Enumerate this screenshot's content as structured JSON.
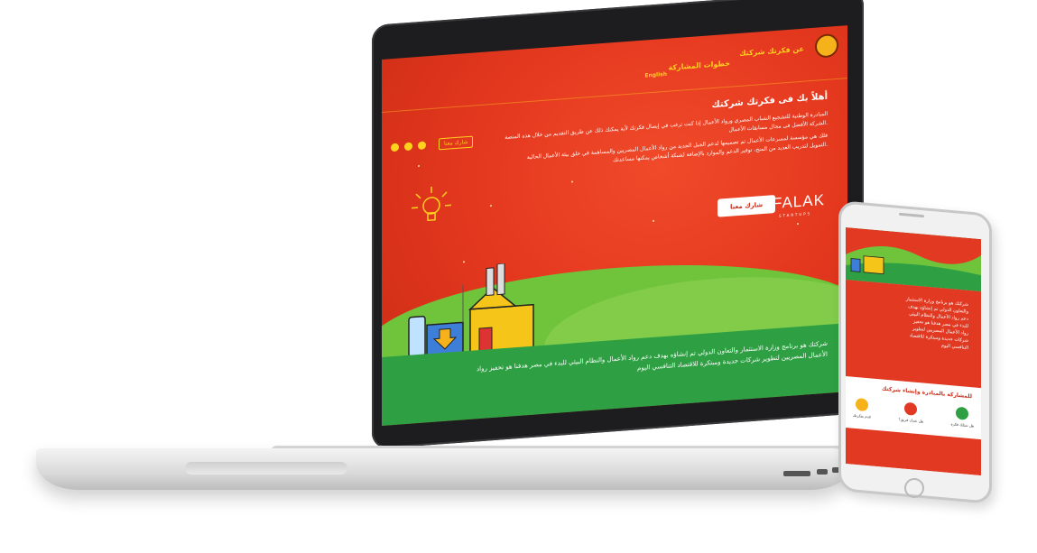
{
  "laptop_site": {
    "nav": {
      "brand_link": "عن فكرتك شركتك",
      "steps_link": "خطوات المشاركة",
      "lang_link": "English",
      "join_button": "شارك معنا"
    },
    "hero": {
      "title": "أهلاً بك فى فكرتك شركتك",
      "paragraph_lines": [
        "المبادرة الوطنية للتشجيع الشباب المصري ورواد الأعمال إذا كنت ترغب في إيصال فكرتك لأية يمكنك ذلك عن طريق التقديم من خلال هذه المنصة",
        "الشركة الأفضل فى مجال مسابقات الأعمال.",
        "فلك هي مؤسسة لمسرعات الأعمال تم تصميمها لدعم الجيل الجديد من رواد الأعمال المصريين والمساهمة في خلق بيئة الأعمال الحالية",
        "التمويل لتدريب العديد من المنح، توفير الدعم والموارد بالإضافة لشبكة أشخاص يمكنها مساعدتك."
      ],
      "cta_button": "شارك معنا",
      "partner_logo": "FALAK",
      "partner_logo_sub": "STARTUPS"
    },
    "footer_lines": [
      "شركتك هو برنامج وزارة الاستثمار والتعاون الدولي تم إنشاؤه بهدف دعم رواد الأعمال والنظام البيئي للبدء في مصر هدفنا هو تحفيز رواد",
      "الأعمال المصريين لتطوير شركات جديدة ومبتكرة للاقتصاد التنافسي اليوم"
    ],
    "colors": {
      "bg": "#e5391f",
      "accent": "#ffd21e",
      "grass": "#2ea043"
    }
  },
  "phone_site": {
    "intro_lines": [
      "شركتك هو برنامج وزارة الاستثمار",
      "والتعاون الدولي تم إنشاؤه بهدف",
      "دعم رواد الأعمال والنظام البيئي",
      "للبدء في مصر هدفنا هو تحفيز",
      "رواد الأعمال المصريين لتطوير",
      "شركات جديدة ومبتكرة للاقتصاد",
      "التنافسي اليوم"
    ],
    "section_title": "للمشاركة بالمبادرة وإنشاء شركتك",
    "steps": [
      {
        "label": "قدم بفكرتك",
        "icon": "lightbulb-icon"
      },
      {
        "label": "هل عندك فريق؟",
        "icon": "team-icon"
      },
      {
        "label": "هل تمتلك فكرة",
        "icon": "idea-icon"
      }
    ]
  }
}
